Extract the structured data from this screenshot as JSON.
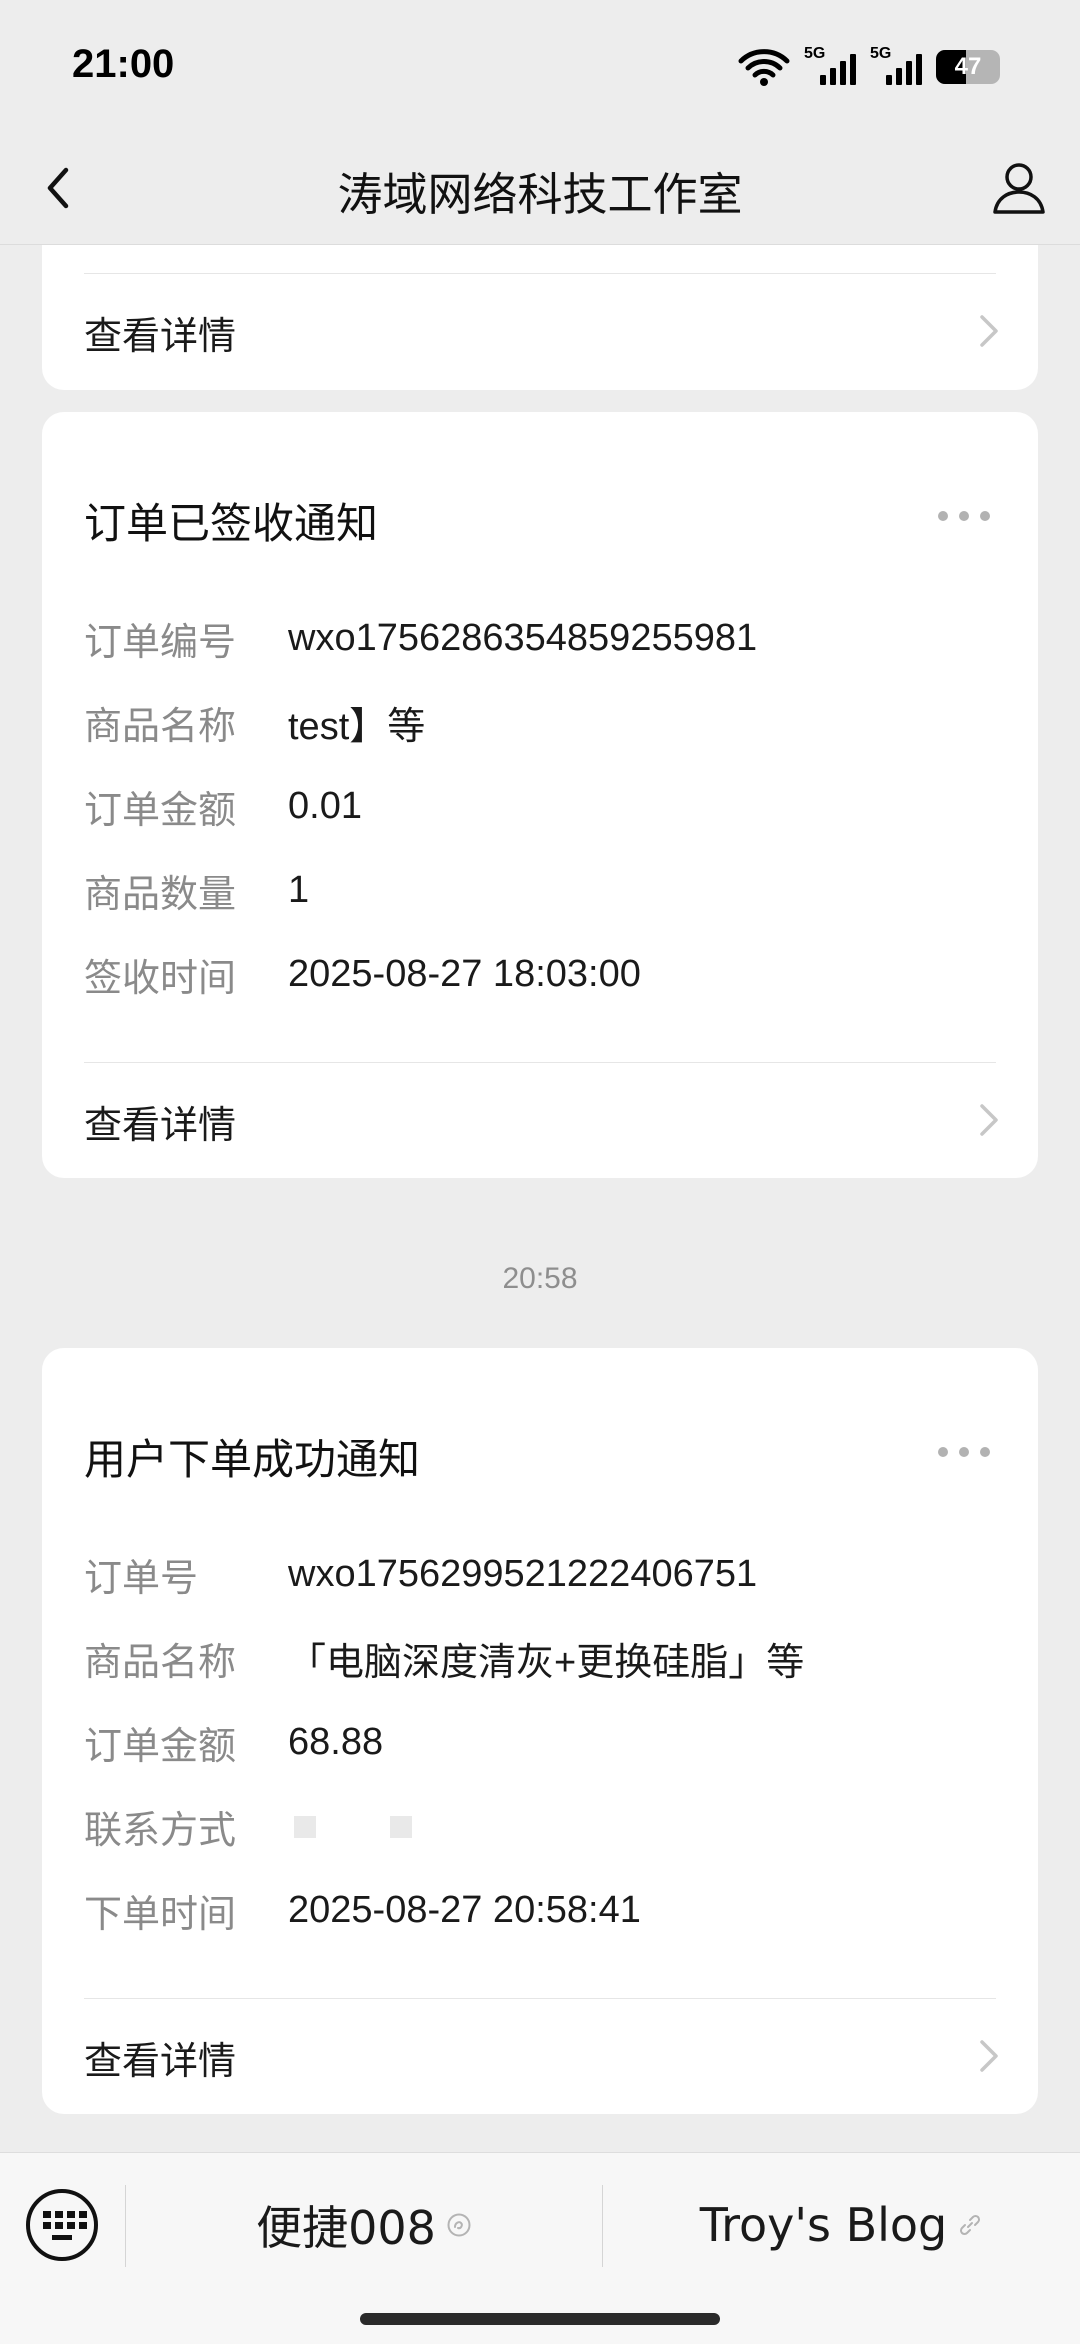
{
  "status_bar": {
    "time": "21:00",
    "network_1": "5G",
    "network_2": "5G",
    "battery": "47",
    "battery_level": 0.47
  },
  "nav": {
    "title": "涛域网络科技工作室",
    "back_icon": "chevron-left-icon",
    "profile_icon": "user-profile-icon"
  },
  "cards": {
    "partial": {
      "detail_label": "查看详情"
    },
    "signed": {
      "title": "订单已签收通知",
      "fields": [
        {
          "label": "订单编号",
          "value": "wxo1756286354859255981"
        },
        {
          "label": "商品名称",
          "value": "test】等"
        },
        {
          "label": "订单金额",
          "value": "0.01"
        },
        {
          "label": "商品数量",
          "value": "1"
        },
        {
          "label": "签收时间",
          "value": "2025-08-27 18:03:00"
        }
      ],
      "detail_label": "查看详情"
    },
    "ordered": {
      "title": "用户下单成功通知",
      "fields": [
        {
          "label": "订单号",
          "value": "wxo1756299521222406751"
        },
        {
          "label": "商品名称",
          "value": "「电脑深度清灰+更换硅脂」等"
        },
        {
          "label": "订单金额",
          "value": "68.88"
        },
        {
          "label": "联系方式",
          "value": ""
        },
        {
          "label": "下单时间",
          "value": "2025-08-27 20:58:41"
        }
      ],
      "detail_label": "查看详情"
    }
  },
  "timestamp": "20:58",
  "bottom_menu": {
    "keyboard_icon": "keyboard-icon",
    "items": [
      {
        "label": "便捷008",
        "icon": "mini-program-icon"
      },
      {
        "label": "Troy's Blog",
        "icon": "link-icon"
      }
    ]
  }
}
